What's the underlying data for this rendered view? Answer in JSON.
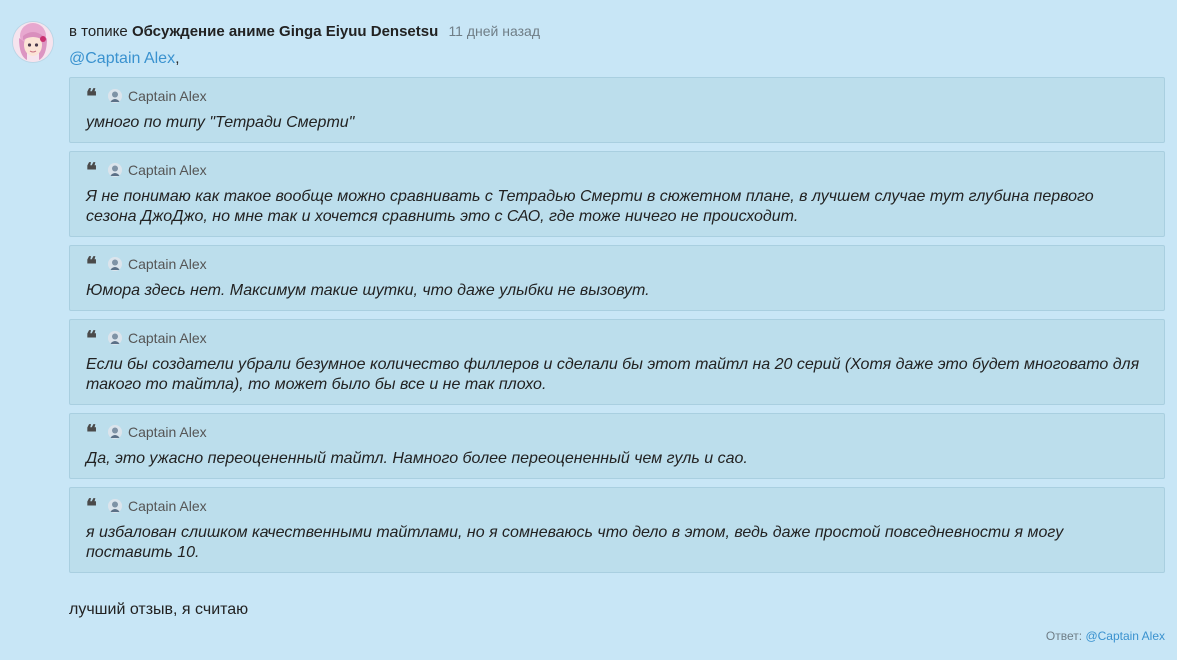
{
  "header": {
    "prefix": "в топике",
    "topic": "Обсуждение аниме Ginga Eiyuu Densetsu",
    "time": "11 дней назад"
  },
  "mention": {
    "handle": "@Captain Alex",
    "suffix": ","
  },
  "quotes": [
    {
      "author": "Captain Alex",
      "text": "умного по типу \"Тетради Смерти\""
    },
    {
      "author": "Captain Alex",
      "text": "Я не понимаю как такое вообще можно сравнивать с Тетрадью Смерти в сюжетном плане, в лучшем случае тут глубина первого сезона ДжоДжо, но мне так и хочется сравнить это с САО, где тоже ничего не происходит."
    },
    {
      "author": "Captain Alex",
      "text": "Юмора здесь нет. Максимум такие шутки, что даже улыбки не вызовут."
    },
    {
      "author": "Captain Alex",
      "text": "Если бы создатели убрали безумное количество филлеров и сделали бы этот тайтл на 20 серий (Хотя даже это будет многовато для такого то тайтла), то может было бы все и не так плохо."
    },
    {
      "author": "Captain Alex",
      "text": "Да, это ужасно переоцененный тайтл. Намного более переоцененный чем гуль и сао."
    },
    {
      "author": "Captain Alex",
      "text": "я избалован слишком качественными тайтлами, но я сомневаюсь что дело в этом, ведь даже простой повседневности я могу поставить 10."
    }
  ],
  "comment": "лучший отзыв, я считаю",
  "reply": {
    "label": "Ответ:",
    "handle": "@Captain Alex"
  },
  "colors": {
    "background": "#c8e6f6",
    "quote_bg": "#bcdeec",
    "link": "#3a92cf"
  }
}
